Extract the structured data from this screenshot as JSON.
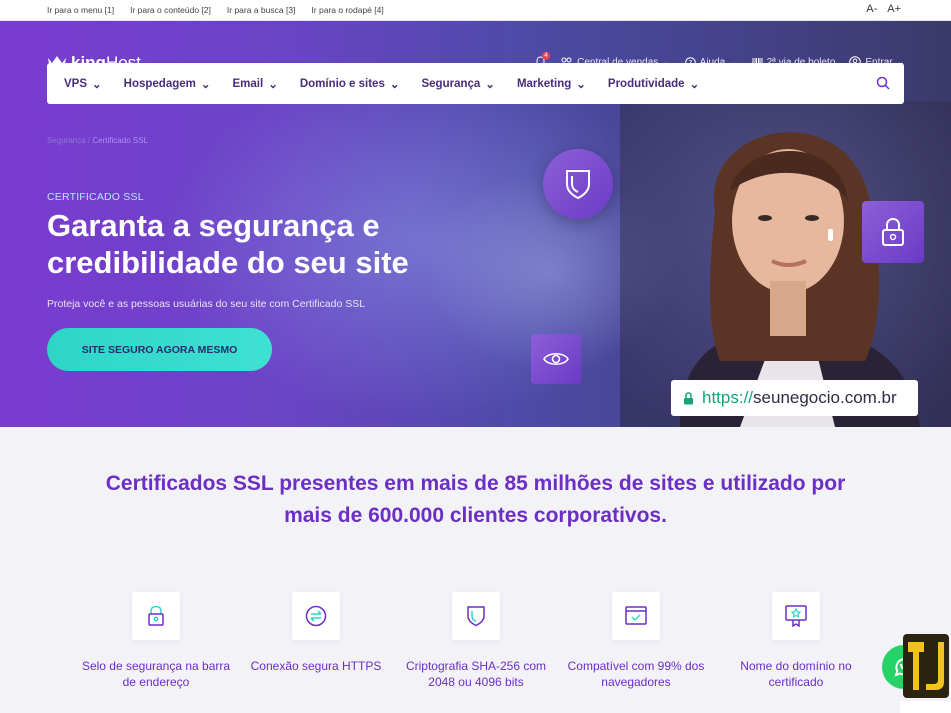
{
  "skiplinks": [
    "Ir para o menu [1]",
    "Ir para o conteúdo [2]",
    "Ir para a busca [3]",
    "Ir para o rodapé [4]"
  ],
  "fontsize": {
    "decrease": "A-",
    "increase": "A+"
  },
  "brand": {
    "name_bold": "king",
    "name_light": "Host"
  },
  "topnav": {
    "notification_count": "4",
    "sales": "Central de vendas",
    "help": "Ajuda",
    "invoice": "2ª via de boleto",
    "login": "Entrar"
  },
  "menu": [
    "VPS",
    "Hospedagem",
    "Email",
    "Domínio e sites",
    "Segurança",
    "Marketing",
    "Produtividade"
  ],
  "breadcrumb": {
    "home": "Segurança",
    "separator": "/",
    "current": "Certificado SSL"
  },
  "hero": {
    "eyebrow": "CERTIFICADO SSL",
    "title": "Garanta a segurança e credibilidade do seu site",
    "lead": "Proteja você e as pessoas usuárias do seu site com Certificado SSL",
    "cta": "SITE SEGURO AGORA MESMO",
    "url_scheme": "https://",
    "url_host": "seunegocio.com.br"
  },
  "headline": "Certificados SSL presentes em mais de 85 milhões de sites e utilizado por mais de 600.000 clientes corporativos.",
  "features": [
    {
      "icon": "padlock-icon",
      "label": "Selo de segurança na barra de endereço"
    },
    {
      "icon": "exchange-icon",
      "label": "Conexão segura HTTPS"
    },
    {
      "icon": "shield-icon",
      "label": "Criptografia SHA-256 com 2048 ou 4096 bits"
    },
    {
      "icon": "browser-check-icon",
      "label": "Compatível com 99% dos navegadores"
    },
    {
      "icon": "certificate-icon",
      "label": "Nome do domínio no certificado"
    }
  ],
  "colors": {
    "accent": "#6c2fc4",
    "cta": "#2ed6c7",
    "hero_bg": "#6a44c6"
  }
}
